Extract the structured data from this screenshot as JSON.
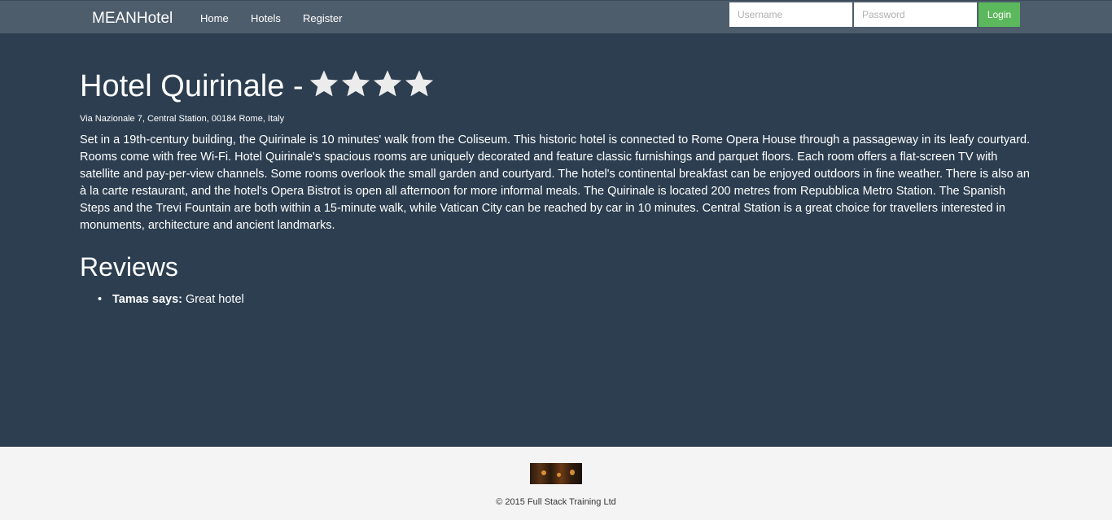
{
  "nav": {
    "brand": "MEANHotel",
    "links": [
      "Home",
      "Hotels",
      "Register"
    ],
    "username_placeholder": "Username",
    "password_placeholder": "Password",
    "login_label": "Login",
    "login_color": "#5cb85c"
  },
  "hotel": {
    "name": "Hotel Quirinale -",
    "stars": 4,
    "address": "Via Nazionale 7, Central Station, 00184 Rome, Italy",
    "description": "Set in a 19th-century building, the Quirinale is 10 minutes' walk from the Coliseum. This historic hotel is connected to Rome Opera House through a passageway in its leafy courtyard. Rooms come with free Wi-Fi. Hotel Quirinale's spacious rooms are uniquely decorated and feature classic furnishings and parquet floors. Each room offers a flat-screen TV with satellite and pay-per-view channels. Some rooms overlook the small garden and courtyard. The hotel's continental breakfast can be enjoyed outdoors in fine weather. There is also an à la carte restaurant, and the hotel's Opera Bistrot is open all afternoon for more informal meals. The Quirinale is located 200 metres from Repubblica Metro Station. The Spanish Steps and the Trevi Fountain are both within a 15-minute walk, while Vatican City can be reached by car in 10 minutes. Central Station is a great choice for travellers interested in monuments, architecture and ancient landmarks."
  },
  "reviews": {
    "title": "Reviews",
    "items": [
      {
        "author": "Tamas says:",
        "text": " Great hotel"
      }
    ]
  },
  "footer": {
    "copyright": "© 2015 Full Stack Training Ltd"
  },
  "icons": {
    "star": "star-icon"
  },
  "colors": {
    "background": "#2c3e50",
    "navbar": "#4e5d6c",
    "footer": "#f4f4f4"
  }
}
